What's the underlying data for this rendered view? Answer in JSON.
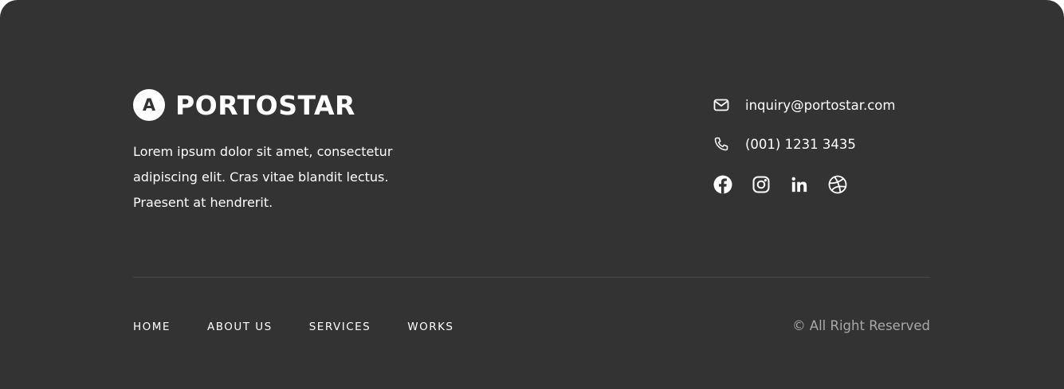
{
  "brand": {
    "logo_letter": "A",
    "name": "PORTOSTAR",
    "description": "Lorem ipsum dolor sit amet, consectetur adipiscing elit. Cras vitae blandit lectus. Praesent at hendrerit."
  },
  "contact": {
    "email": "inquiry@portostar.com",
    "phone": "(001) 1231 3435",
    "email_icon": "mail-icon",
    "phone_icon": "phone-icon"
  },
  "socials": [
    {
      "name": "facebook-icon"
    },
    {
      "name": "instagram-icon"
    },
    {
      "name": "linkedin-icon"
    },
    {
      "name": "dribbble-icon"
    }
  ],
  "nav": {
    "items": [
      {
        "label": "HOME"
      },
      {
        "label": "ABOUT US"
      },
      {
        "label": "SERVICES"
      },
      {
        "label": "WORKS"
      }
    ]
  },
  "copyright": "© All Right Reserved",
  "colors": {
    "background": "#333333",
    "text": "#ffffff",
    "muted": "#a8a8a8",
    "divider": "#474747"
  }
}
